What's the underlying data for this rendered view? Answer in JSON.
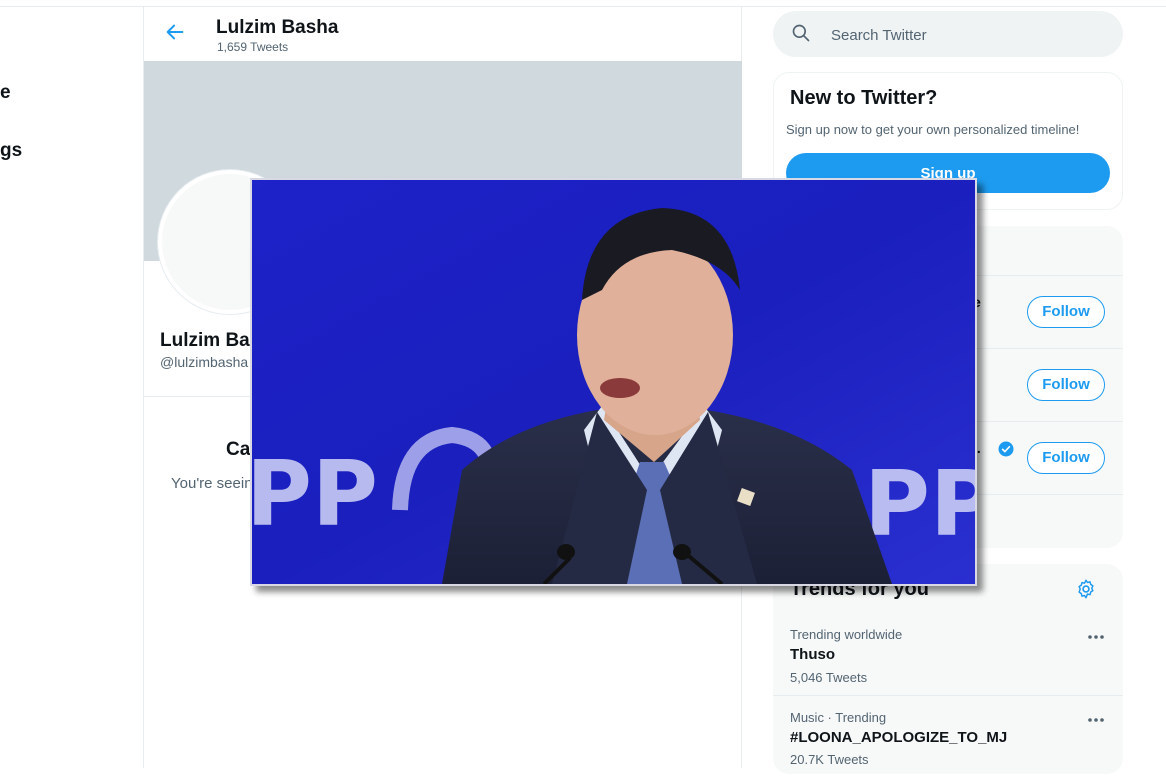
{
  "left_nav": {
    "items": [
      {
        "label": "e"
      },
      {
        "label": "gs"
      }
    ]
  },
  "header": {
    "name": "Lulzim Basha",
    "tweet_count": "1,659 Tweets"
  },
  "profile": {
    "display_name": "Lulzim Ba",
    "handle": "@lulzimbasha",
    "warning_title": "Ca",
    "warning_text": "You're seein"
  },
  "search": {
    "placeholder": "Search Twitter"
  },
  "signup": {
    "title": "New to Twitter?",
    "text": "Sign up now to get your own personalized timeline!",
    "button": "Sign up"
  },
  "who_to_follow": {
    "items": [
      {
        "name_fragment": "e",
        "button": "Follow",
        "verified": false
      },
      {
        "name_fragment": "",
        "button": "Follow",
        "verified": false
      },
      {
        "name_fragment": "..",
        "button": "Follow",
        "verified": true
      }
    ]
  },
  "trends": {
    "title": "Trends for you",
    "items": [
      {
        "meta": "Trending worldwide",
        "name": "Thuso",
        "count": "5,046 Tweets"
      },
      {
        "meta": "Music · Trending",
        "name": "#LOONA_APOLOGIZE_TO_MJ",
        "count": "20.7K Tweets"
      }
    ]
  },
  "overlay": {
    "backdrop_text": "PP"
  },
  "colors": {
    "accent": "#1d9bf0",
    "backdrop_blue": "#1a1ec8"
  }
}
